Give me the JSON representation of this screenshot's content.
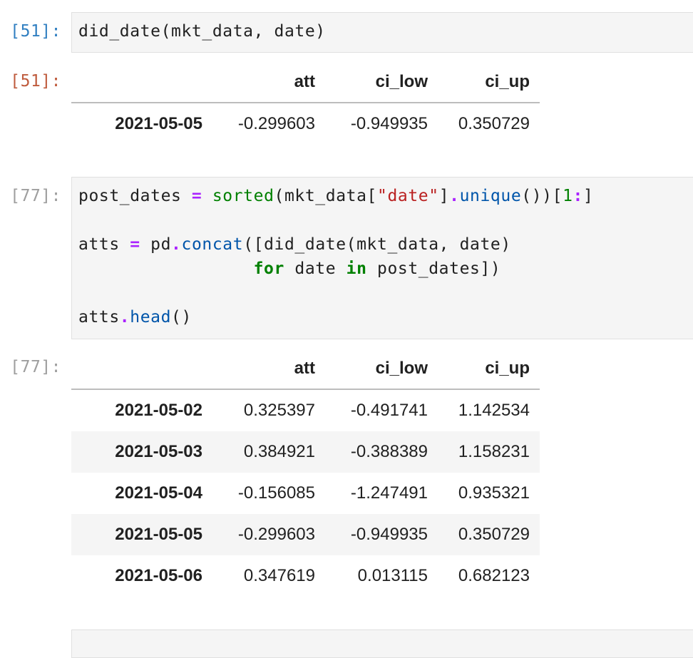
{
  "cells": [
    {
      "in_prompt": "[51]:",
      "code_lines": [
        "did_date(mkt_data, date)"
      ],
      "out_prompt": "[51]:",
      "table": {
        "columns": [
          "att",
          "ci_low",
          "ci_up"
        ],
        "rows": [
          {
            "index": "2021-05-05",
            "att": "-0.299603",
            "ci_low": "-0.949935",
            "ci_up": "0.350729"
          }
        ]
      }
    },
    {
      "in_prompt": "[77]:",
      "code_lines": [
        "post_dates = sorted(mkt_data[\"date\"].unique())[1:]",
        "",
        "atts = pd.concat([did_date(mkt_data, date)",
        "                  for date in post_dates])",
        "",
        "atts.head()"
      ],
      "out_prompt": "[77]:",
      "table": {
        "columns": [
          "att",
          "ci_low",
          "ci_up"
        ],
        "rows": [
          {
            "index": "2021-05-02",
            "att": "0.325397",
            "ci_low": "-0.491741",
            "ci_up": "1.142534"
          },
          {
            "index": "2021-05-03",
            "att": "0.384921",
            "ci_low": "-0.388389",
            "ci_up": "1.158231"
          },
          {
            "index": "2021-05-04",
            "att": "-0.156085",
            "ci_low": "-1.247491",
            "ci_up": "0.935321"
          },
          {
            "index": "2021-05-05",
            "att": "-0.299603",
            "ci_low": "-0.949935",
            "ci_up": "0.350729"
          },
          {
            "index": "2021-05-06",
            "att": "0.347619",
            "ci_low": "0.013115",
            "ci_up": "0.682123"
          }
        ]
      }
    }
  ],
  "colors": {
    "prompt_in_active": "#307fc1",
    "prompt_out_active": "#bf5b3d",
    "prompt_idle": "#9e9e9e",
    "editor_bg": "#f5f5f5",
    "keyword": "#008000",
    "operator": "#aa22ff",
    "function": "#0055aa",
    "string": "#ba2121"
  }
}
